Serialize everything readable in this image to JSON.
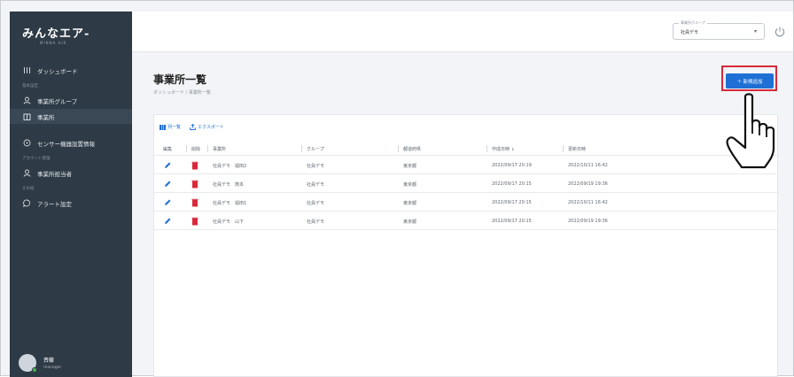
{
  "sidebar": {
    "logo_text": "みんなエア-",
    "logo_sub": "MINNA AIR",
    "items": [
      {
        "label": "ダッシュボード",
        "icon": "dashboard-icon",
        "active": false
      },
      {
        "label": "事業所グループ",
        "icon": "user-group-icon",
        "active": false
      },
      {
        "label": "事業所",
        "icon": "building-icon",
        "active": true
      },
      {
        "label": "センサー機器設置情報",
        "icon": "sensor-icon",
        "active": false
      },
      {
        "label": "事業所担当者",
        "icon": "person-icon",
        "active": false
      },
      {
        "label": "アラート設定",
        "icon": "chat-bubble-icon",
        "active": false
      }
    ],
    "sections": [
      "基本設定",
      "アカウント管理",
      "その他"
    ],
    "user": {
      "name": "斉藤",
      "role": "manager"
    }
  },
  "topbar": {
    "group_label": "事業所グループ",
    "group_value": "社員デモ"
  },
  "page": {
    "title": "事業所一覧",
    "breadcrumb": "ダッシュボード / 事業所一覧",
    "add_button": "＋ 新規追加"
  },
  "toolbar": {
    "columns_label": "列一覧",
    "export_label": "エクスポート"
  },
  "table": {
    "headers": [
      "編集",
      "削除",
      "事業所",
      "グループ",
      "都道府県",
      "作成日時 ↓",
      "更新日時"
    ],
    "rows": [
      {
        "office": "社員デモ　堀田2",
        "group": "社員デモ",
        "pref": "東京都",
        "created": "2022/09/17 20:19",
        "updated": "2022/10/11 16:42"
      },
      {
        "office": "社員デモ　熊本",
        "group": "社員デモ",
        "pref": "東京都",
        "created": "2022/09/17 20:15",
        "updated": "2022/09/19 19:36"
      },
      {
        "office": "社員デモ　堀田1",
        "group": "社員デモ",
        "pref": "東京都",
        "created": "2022/09/17 20:15",
        "updated": "2022/10/11 16:42"
      },
      {
        "office": "社員デモ　山下",
        "group": "社員デモ",
        "pref": "東京都",
        "created": "2022/09/17 20:15",
        "updated": "2022/09/19 19:36"
      }
    ]
  },
  "colors": {
    "sidebar_bg": "#2e3a45",
    "accent": "#1f6fd4",
    "highlight": "#d8283a",
    "edit": "#1f6fd4",
    "delete": "#d8283a"
  },
  "annotation_icon": "pointing-hand-icon"
}
